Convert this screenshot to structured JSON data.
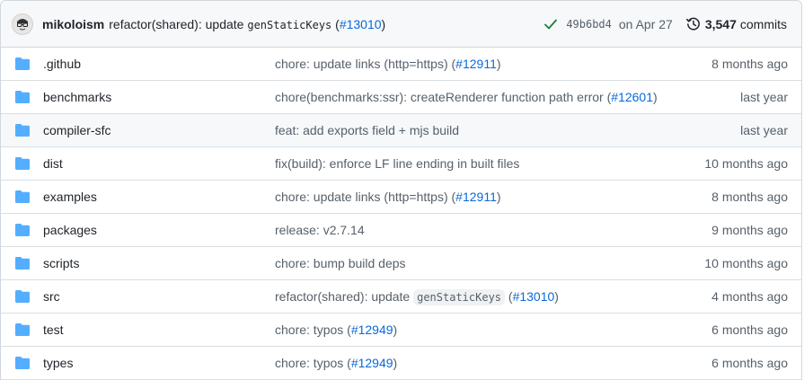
{
  "latest_commit": {
    "author": "mikoloism",
    "message_prefix": "refactor(shared): update",
    "message_code": "genStaticKeys",
    "message_open": "(",
    "message_link": "#13010",
    "message_close": ")",
    "sha": "49b6bd4",
    "date": "on Apr 27",
    "commits_count": "3,547",
    "commits_label": "commits",
    "status_color": "#1a7f37"
  },
  "files": [
    {
      "name": ".github",
      "commit_text": "chore: update links (http=https) (",
      "commit_code": "",
      "commit_link": "#12911",
      "commit_close": ")",
      "age": "8 months ago"
    },
    {
      "name": "benchmarks",
      "commit_text": "chore(benchmarks:ssr): createRenderer function path error (",
      "commit_code": "",
      "commit_link": "#12601",
      "commit_close": ")",
      "age": "last year"
    },
    {
      "name": "compiler-sfc",
      "commit_text": "feat: add exports field + mjs build",
      "commit_code": "",
      "commit_link": "",
      "commit_close": "",
      "age": "last year"
    },
    {
      "name": "dist",
      "commit_text": "fix(build): enforce LF line ending in built files",
      "commit_code": "",
      "commit_link": "",
      "commit_close": "",
      "age": "10 months ago"
    },
    {
      "name": "examples",
      "commit_text": "chore: update links (http=https) (",
      "commit_code": "",
      "commit_link": "#12911",
      "commit_close": ")",
      "age": "8 months ago"
    },
    {
      "name": "packages",
      "commit_text": "release: v2.7.14",
      "commit_code": "",
      "commit_link": "",
      "commit_close": "",
      "age": "9 months ago"
    },
    {
      "name": "scripts",
      "commit_text": "chore: bump build deps",
      "commit_code": "",
      "commit_link": "",
      "commit_close": "",
      "age": "10 months ago"
    },
    {
      "name": "src",
      "commit_text": "refactor(shared): update ",
      "commit_code": "genStaticKeys",
      "commit_link": "#13010",
      "commit_close": ")",
      "age": "4 months ago"
    },
    {
      "name": "test",
      "commit_text": "chore: typos (",
      "commit_code": "",
      "commit_link": "#12949",
      "commit_close": ")",
      "age": "6 months ago"
    },
    {
      "name": "types",
      "commit_text": "chore: typos (",
      "commit_code": "",
      "commit_link": "#12949",
      "commit_close": ")",
      "age": "6 months ago"
    }
  ],
  "icons": {
    "folder": "folder-icon",
    "check": "check-icon",
    "history": "history-icon",
    "folder_color": "#54aeff"
  }
}
